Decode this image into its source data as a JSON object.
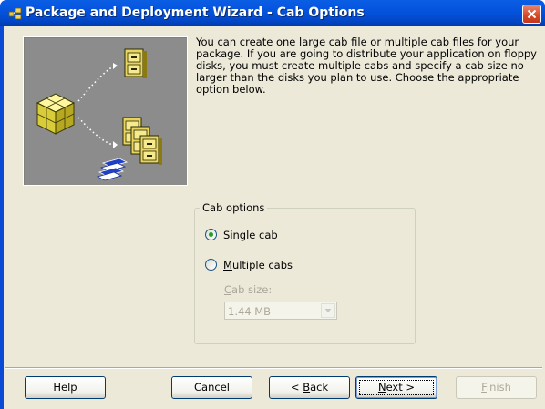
{
  "window": {
    "title": "Package and Deployment Wizard - Cab Options",
    "title_icon": "package-wizard-icon",
    "close_icon": "close-icon"
  },
  "description": "You can create one large cab file or multiple cab files for your package. If you are going to distribute your application on floppy disks, you must create multiple cabs and specify a cab size no larger than the disks you plan to use. Choose the appropriate option below.",
  "cab_options": {
    "group_label": "Cab options",
    "single": {
      "before": "",
      "mnemonic": "S",
      "after": "ingle cab",
      "selected": true
    },
    "multiple": {
      "before": "",
      "mnemonic": "M",
      "after": "ultiple cabs",
      "selected": false
    },
    "cab_size": {
      "label_before": "",
      "label_mnemonic": "C",
      "label_after": "ab size:",
      "value": "1.44 MB",
      "enabled": false
    }
  },
  "buttons": {
    "help": "Help",
    "cancel": "Cancel",
    "back_prefix": "< ",
    "back_mnemonic": "B",
    "back_suffix": "ack",
    "next_mnemonic": "N",
    "next_suffix": "ext >",
    "finish_mnemonic": "F",
    "finish_suffix": "inish"
  },
  "colors": {
    "titlebar": "#0453dc",
    "dialog_bg": "#ece9d8",
    "picture_bg": "#8c8c8c",
    "disabled_text": "#aca899",
    "radio_dot": "#21a121"
  }
}
